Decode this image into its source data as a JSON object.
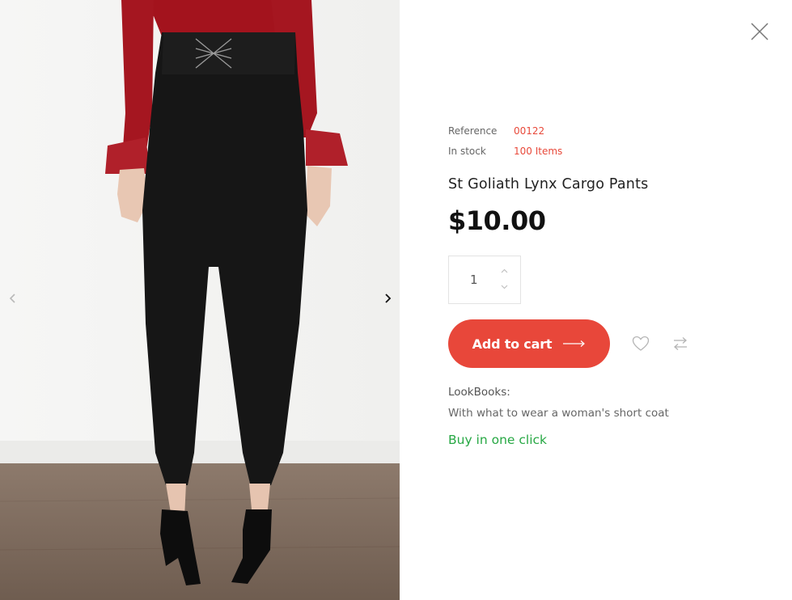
{
  "product": {
    "reference_label": "Reference",
    "reference_value": "00122",
    "stock_label": "In stock",
    "stock_value": "100 Items",
    "title": "St Goliath Lynx Cargo Pants",
    "price": "$10.00",
    "quantity": "1"
  },
  "actions": {
    "add_to_cart": "Add to cart"
  },
  "lookbooks": {
    "label": "LookBooks:",
    "link": "With what to wear a woman's short coat"
  },
  "buy_one_click": "Buy in one click",
  "colors": {
    "accent": "#e8473a",
    "link_red": "#e8493a",
    "green": "#27a844"
  },
  "icons": {
    "close": "close-icon",
    "prev": "chevron-left-icon",
    "next": "chevron-right-icon",
    "wishlist": "heart-icon",
    "compare": "compare-arrows-icon",
    "cart_arrow": "long-arrow-right-icon"
  }
}
